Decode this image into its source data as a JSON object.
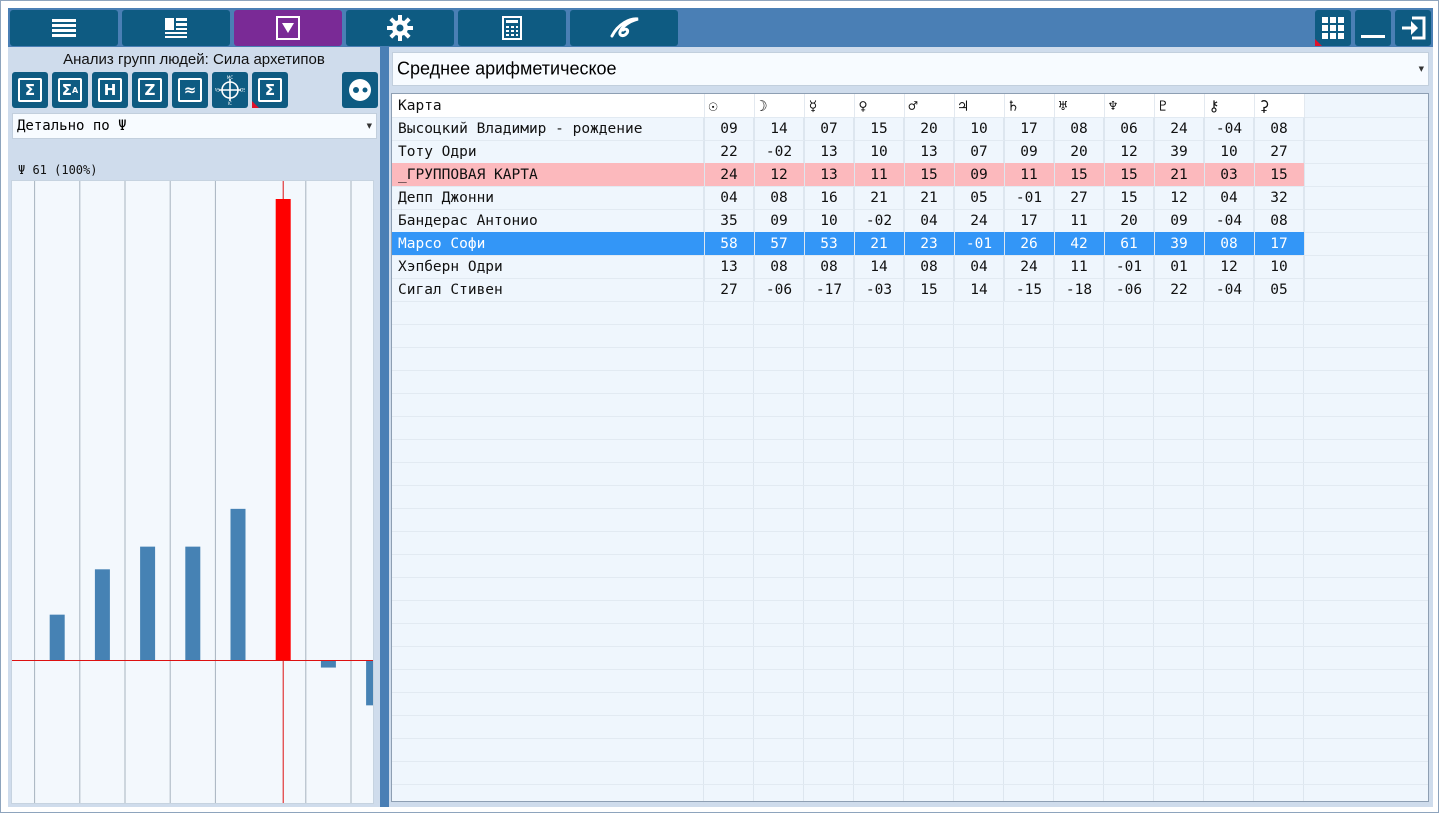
{
  "toolbar": {
    "left_buttons": [
      {
        "name": "menu-list",
        "icon": "list-icon"
      },
      {
        "name": "layout",
        "icon": "layout-icon"
      },
      {
        "name": "filter",
        "icon": "triangle-down-icon",
        "active": true
      },
      {
        "name": "settings",
        "icon": "gear-icon"
      },
      {
        "name": "calculator",
        "icon": "calculator-icon"
      },
      {
        "name": "logo",
        "icon": "logo-swirl-icon"
      }
    ],
    "right_buttons": [
      {
        "name": "grid",
        "icon": "grid-icon"
      },
      {
        "name": "minimize",
        "icon": "minimize-icon"
      },
      {
        "name": "exit",
        "icon": "exit-icon"
      }
    ],
    "active_color": "#7a2a96",
    "button_color": "#0e5b82",
    "bar_color": "#4a7fb5"
  },
  "left": {
    "title": "Анализ групп людей: Сила архетипов",
    "tool_buttons": [
      {
        "name": "sum",
        "glyph": "Σ"
      },
      {
        "name": "sum-a",
        "glyph": "Σ"
      },
      {
        "name": "h",
        "glyph": "H"
      },
      {
        "name": "z",
        "glyph": "Z"
      },
      {
        "name": "wave",
        "glyph": "≈"
      },
      {
        "name": "crosshair",
        "glyph": "⊕"
      },
      {
        "name": "sum-page",
        "glyph": "Σ"
      }
    ],
    "sum_a_sub": "A",
    "crosshair_labels": {
      "top": "MC",
      "bottom": "IC",
      "left": "AS",
      "right": "DS"
    },
    "combo_value": "Детально по Ψ",
    "chart_label": "Ψ 61 (100%)"
  },
  "right": {
    "combo_value": "Среднее арифметическое"
  },
  "table": {
    "header_name": "Карта",
    "columns": [
      "☉",
      "☽",
      "☿",
      "♀",
      "♂",
      "♃",
      "♄",
      "♅",
      "♆",
      "♇",
      "⚷",
      "⚳"
    ],
    "rows": [
      {
        "name": "Высоцкий Владимир - рождение",
        "values": [
          "09",
          "14",
          "07",
          "15",
          "20",
          "10",
          "17",
          "08",
          "06",
          "24",
          "-04",
          "08"
        ],
        "style": ""
      },
      {
        "name": "Тоту Одри",
        "values": [
          "22",
          "-02",
          "13",
          "10",
          "13",
          "07",
          "09",
          "20",
          "12",
          "39",
          "10",
          "27"
        ],
        "style": ""
      },
      {
        "name": "_ГРУППОВАЯ КАРТА",
        "values": [
          "24",
          "12",
          "13",
          "11",
          "15",
          "09",
          "11",
          "15",
          "15",
          "21",
          "03",
          "15"
        ],
        "style": "group"
      },
      {
        "name": "Депп Джонни",
        "values": [
          "04",
          "08",
          "16",
          "21",
          "21",
          "05",
          "-01",
          "27",
          "15",
          "12",
          "04",
          "32"
        ],
        "style": ""
      },
      {
        "name": "Бандерас Антонио",
        "values": [
          "35",
          "09",
          "10",
          "-02",
          "04",
          "24",
          "17",
          "11",
          "20",
          "09",
          "-04",
          "08"
        ],
        "style": ""
      },
      {
        "name": "Марсо Софи",
        "values": [
          "58",
          "57",
          "53",
          "21",
          "23",
          "-01",
          "26",
          "42",
          "61",
          "39",
          "08",
          "17"
        ],
        "style": "selected"
      },
      {
        "name": "Хэпберн Одри",
        "values": [
          "13",
          "08",
          "08",
          "14",
          "08",
          "04",
          "24",
          "11",
          "-01",
          "01",
          "12",
          "10"
        ],
        "style": ""
      },
      {
        "name": "Сигал Стивен",
        "values": [
          "27",
          "-06",
          "-17",
          "-03",
          "15",
          "14",
          "-15",
          "-18",
          "-06",
          "22",
          "-04",
          "05"
        ],
        "style": ""
      }
    ],
    "group_color": "#fcb9bd",
    "selected_color": "#3396f7"
  },
  "chart_data": {
    "type": "bar",
    "categories": [
      "Высоцкий Владимир - рождение",
      "Тоту Одри",
      "Депп Джонни",
      "Бандерас Антонио",
      "Марсо Софи",
      "Хэпберн Одри",
      "Сигал Стивен"
    ],
    "values": [
      6,
      12,
      15,
      15,
      20,
      61,
      -1,
      -6
    ],
    "bar_slots": [
      1,
      2,
      3,
      4,
      5,
      6,
      7,
      8
    ],
    "highlight_index": 5,
    "ylim": [
      -20,
      65
    ],
    "grid": "vertical",
    "colors": {
      "bar": "#4682b4",
      "highlight": "#ff0000",
      "zero_line": "#dd1111"
    }
  }
}
